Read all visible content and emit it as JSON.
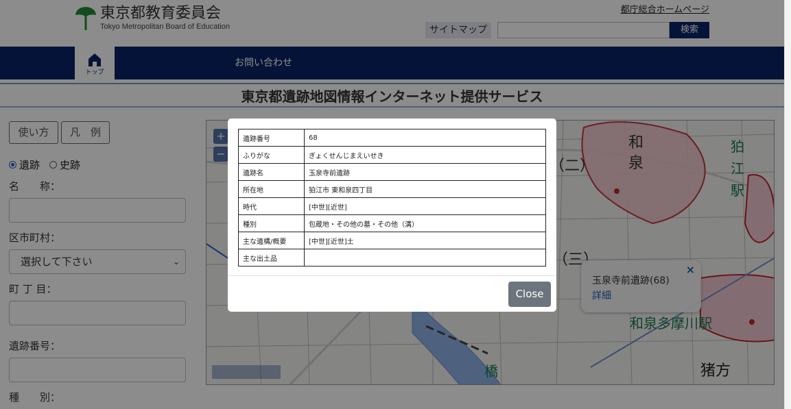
{
  "header": {
    "logo_title": "東京都教育委員会",
    "logo_subtitle": "Tokyo Metropolitan Board of Education",
    "metro_link": "都庁総合ホームページ",
    "sitemap_label": "サイトマップ",
    "search_placeholder": "",
    "search_button": "検索"
  },
  "nav": {
    "home_label": "トップ",
    "contact_label": "お問い合わせ"
  },
  "page": {
    "title": "東京都遺跡地図情報インターネット提供サービス"
  },
  "sidebar": {
    "usage_button": "使い方",
    "legend_button": "凡　例",
    "radio_site": "遺跡",
    "radio_historic": "史跡",
    "radio_selected": "遺跡",
    "name_label": "名　　称：",
    "municipality_label": "区市町村：",
    "municipality_value": "選択して下さい",
    "town_label": "町 丁 目：",
    "site_number_label": "遺跡番号：",
    "type_label": "種　　別："
  },
  "map": {
    "zoom_in": "+",
    "zoom_out": "−",
    "popup": {
      "title": "玉泉寺前遺跡(68)",
      "detail_link": "詳細",
      "close": "×"
    },
    "labels": {
      "label_wa": "和",
      "label_izumi": "泉",
      "label_two": "（二）",
      "label_three": "（三）",
      "label_station_a": "狛",
      "label_station_b": "江",
      "label_station_c": "駅",
      "label_izumi_tamagawa": "和泉多摩川駅",
      "label_inokata": "猪方",
      "label_bridge": "橋"
    }
  },
  "modal": {
    "rows": [
      {
        "key": "遺跡番号",
        "value": "68"
      },
      {
        "key": "ふりがな",
        "value": "ぎょくせんじまえいせき"
      },
      {
        "key": "遺跡名",
        "value": "玉泉寺前遺跡"
      },
      {
        "key": "所在地",
        "value": "狛江市 東和泉四丁目"
      },
      {
        "key": "時代",
        "value": "[中世][近世]"
      },
      {
        "key": "種別",
        "value": "包蔵地・その他の墓・その他（溝）"
      },
      {
        "key": "主な遺構/概要",
        "value": "[中世][近世]土"
      },
      {
        "key": "主な出土品",
        "value": ""
      }
    ],
    "close_label": "Close"
  },
  "colors": {
    "navy": "#0a2366",
    "close_button": "#6c757d",
    "link_blue": "#1a5fb4",
    "site_red": "#d9363e"
  },
  "icons": {
    "home": "home-icon",
    "ginkgo": "ginkgo-logo-icon",
    "close": "close-icon",
    "chevron": "chevron-down-icon"
  }
}
